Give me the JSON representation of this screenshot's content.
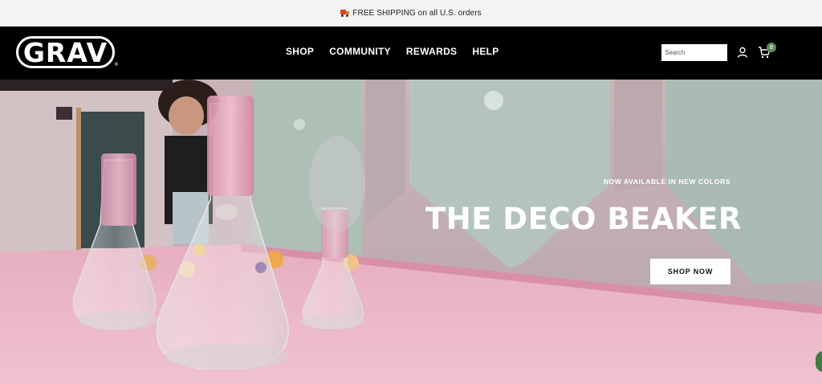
{
  "announcement": {
    "icon": "truck-icon",
    "text": "FREE SHIPPING on all U.S. orders"
  },
  "header": {
    "logo_text": "GRAV",
    "logo_mark": "®",
    "nav": [
      {
        "label": "SHOP"
      },
      {
        "label": "COMMUNITY"
      },
      {
        "label": "REWARDS"
      },
      {
        "label": "HELP"
      }
    ],
    "search_placeholder": "Search",
    "account_icon": "user-icon",
    "cart_icon": "cart-icon",
    "cart_count": "0"
  },
  "hero": {
    "eyebrow": "NOW AVAILABLE IN NEW COLORS",
    "title": "THE DECO BEAKER",
    "cta_label": "SHOP NOW",
    "chat_icon": "chat-icon"
  },
  "colors": {
    "announce_bg": "#f3f3f3",
    "header_bg": "#000000",
    "cart_badge": "#5b8a5b",
    "glass_pink": "#e3a9bd",
    "table_pink": "#e9b3c4",
    "headboard_sage": "#aebfb6"
  }
}
